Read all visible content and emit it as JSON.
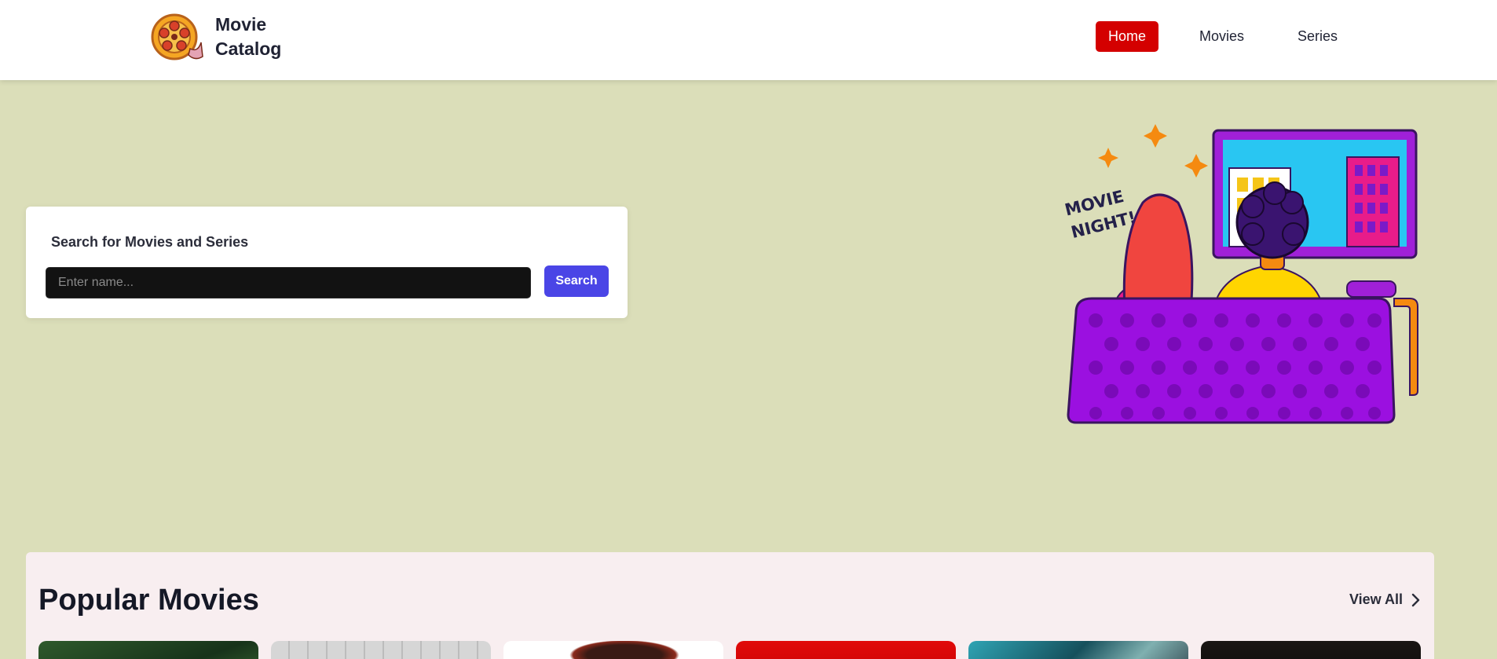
{
  "brand": {
    "name_line1": "Movie",
    "name_line2": "Catalog",
    "logo_icon": "film-reel-icon"
  },
  "nav": {
    "items": [
      {
        "label": "Home",
        "active": true
      },
      {
        "label": "Movies",
        "active": false
      },
      {
        "label": "Series",
        "active": false
      }
    ],
    "active_color": "#d40000"
  },
  "search": {
    "heading": "Search for Movies and Series",
    "placeholder": "Enter name...",
    "value": "",
    "button_label": "Search",
    "button_color": "#4a45e6"
  },
  "hero": {
    "illustration_text_line1": "MOVIE",
    "illustration_text_line2": "NIGHT!"
  },
  "popular": {
    "title": "Popular Movies",
    "view_all_label": "View All",
    "card_count": 6
  },
  "colors": {
    "page_background": "#dbdeb9",
    "section_background": "#f8eef0"
  }
}
